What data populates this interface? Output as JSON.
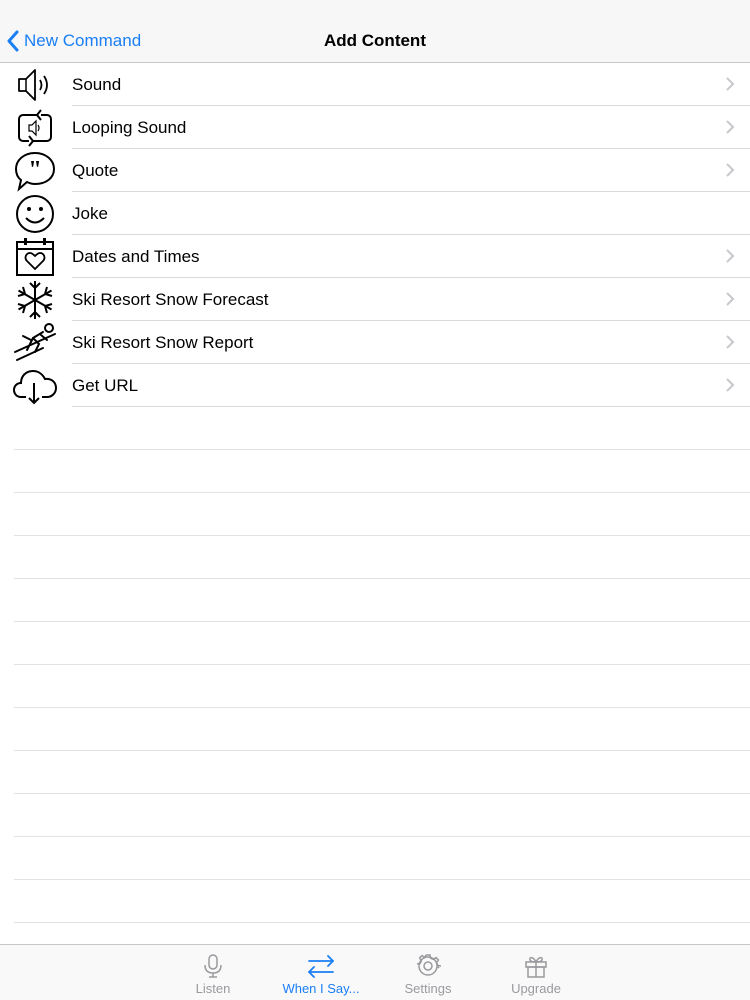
{
  "navbar": {
    "back_label": "New Command",
    "title": "Add Content"
  },
  "items": [
    {
      "label": "Sound",
      "icon": "speaker-icon",
      "chevron": true
    },
    {
      "label": "Looping Sound",
      "icon": "looping-sound-icon",
      "chevron": true
    },
    {
      "label": "Quote",
      "icon": "quote-bubble-icon",
      "chevron": true
    },
    {
      "label": "Joke",
      "icon": "smiley-icon",
      "chevron": false
    },
    {
      "label": "Dates and Times",
      "icon": "calendar-heart-icon",
      "chevron": true
    },
    {
      "label": "Ski Resort Snow Forecast",
      "icon": "snowflake-icon",
      "chevron": true
    },
    {
      "label": "Ski Resort Snow Report",
      "icon": "skier-icon",
      "chevron": true
    },
    {
      "label": "Get URL",
      "icon": "cloud-download-icon",
      "chevron": true
    }
  ],
  "tabbar": {
    "tabs": [
      {
        "label": "Listen",
        "icon": "microphone-icon",
        "active": false
      },
      {
        "label": "When I Say...",
        "icon": "swap-arrows-icon",
        "active": true
      },
      {
        "label": "Settings",
        "icon": "gear-icon",
        "active": false
      },
      {
        "label": "Upgrade",
        "icon": "gift-icon",
        "active": false
      }
    ]
  },
  "colors": {
    "accent": "#1a7ff4",
    "inactive_tab": "#9a9a9e",
    "separator": "#d9d9dd"
  }
}
